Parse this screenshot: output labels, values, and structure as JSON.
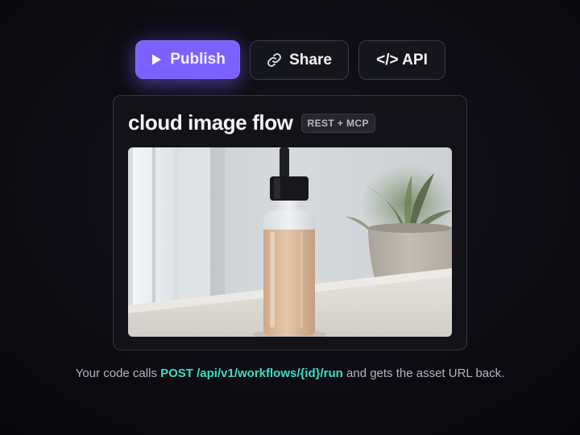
{
  "toolbar": {
    "publish_label": "Publish",
    "share_label": "Share",
    "api_label": "</> API",
    "icons": {
      "publish": "play-icon",
      "share": "link-icon"
    }
  },
  "card": {
    "title": "cloud image flow",
    "badge": "REST + MCP",
    "preview_icon": "dropper-bottle-photo"
  },
  "caption": {
    "prefix": "Your code calls ",
    "endpoint": "POST /api/v1/workflows/{id}/run",
    "suffix": " and gets the asset URL back."
  },
  "colors": {
    "accent": "#7b61ff",
    "code": "#3ddfc2",
    "background": "#0c0c12"
  }
}
